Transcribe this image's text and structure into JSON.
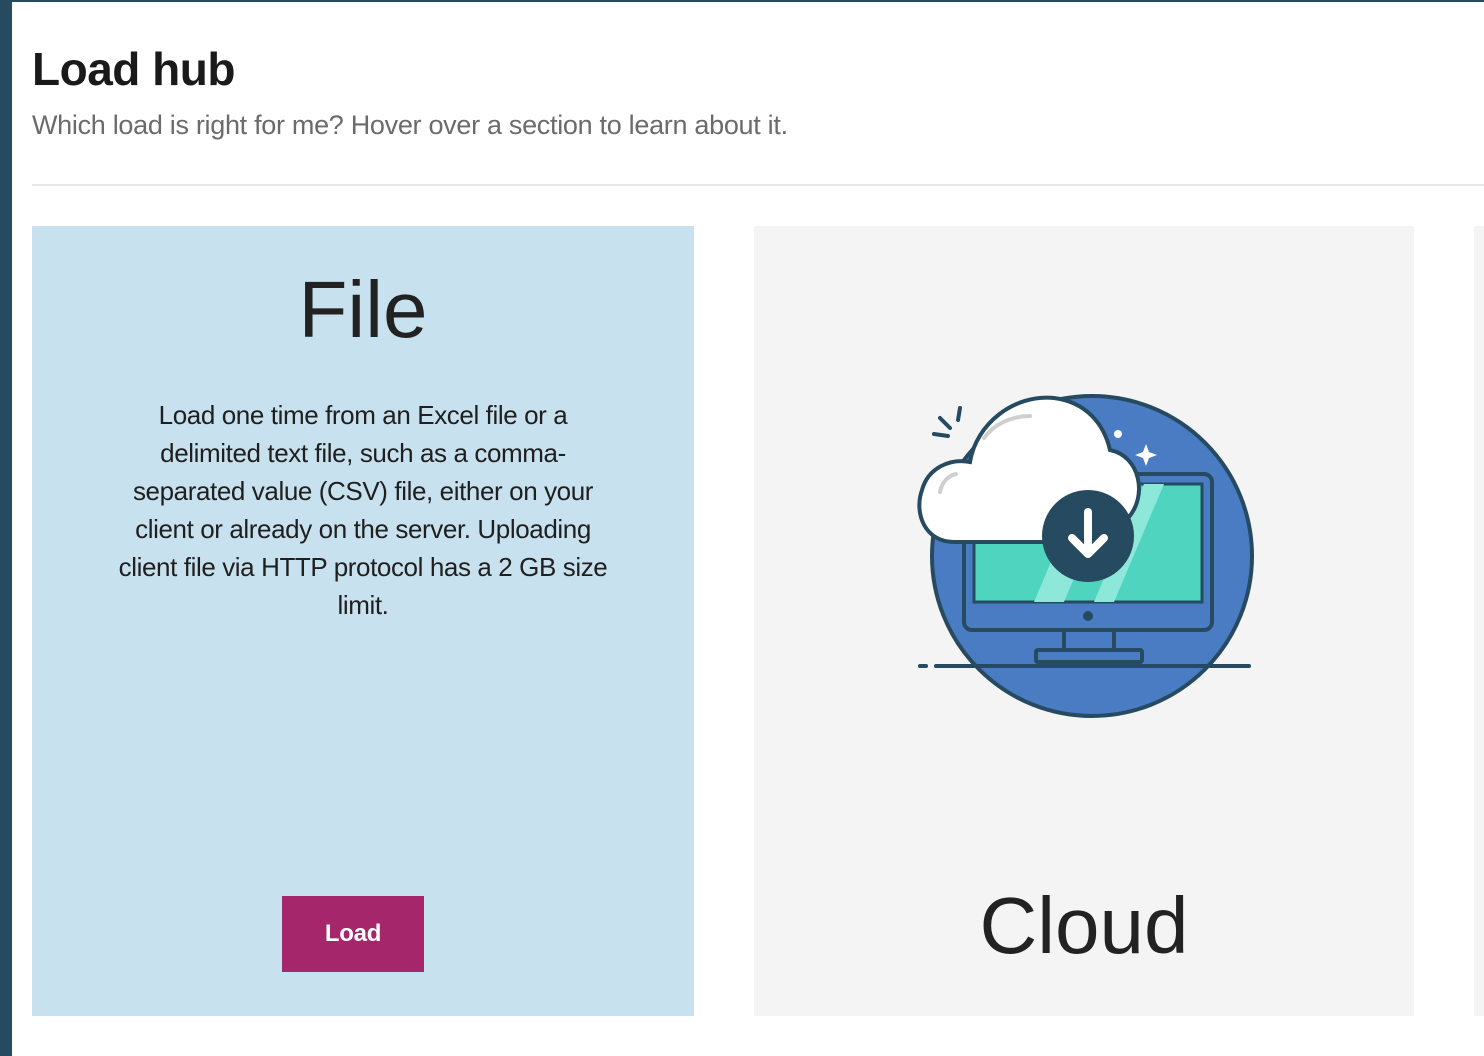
{
  "header": {
    "title": "Load hub",
    "subtitle": "Which load is right for me? Hover over a section to learn about it."
  },
  "cards": {
    "file": {
      "title": "File",
      "description": "Load one time from an Excel file or a delimited text file, such as a comma-separated value (CSV) file, either on your client or already on the server. Uploading client file via HTTP protocol has a 2 GB size limit.",
      "button_label": "Load",
      "background": "#c8e1ef",
      "button_color": "#a5266b"
    },
    "cloud": {
      "title": "Cloud",
      "icon": "cloud-download-icon",
      "background": "#f4f4f4"
    }
  },
  "colors": {
    "rail": "#264a60",
    "accent": "#a5266b"
  }
}
